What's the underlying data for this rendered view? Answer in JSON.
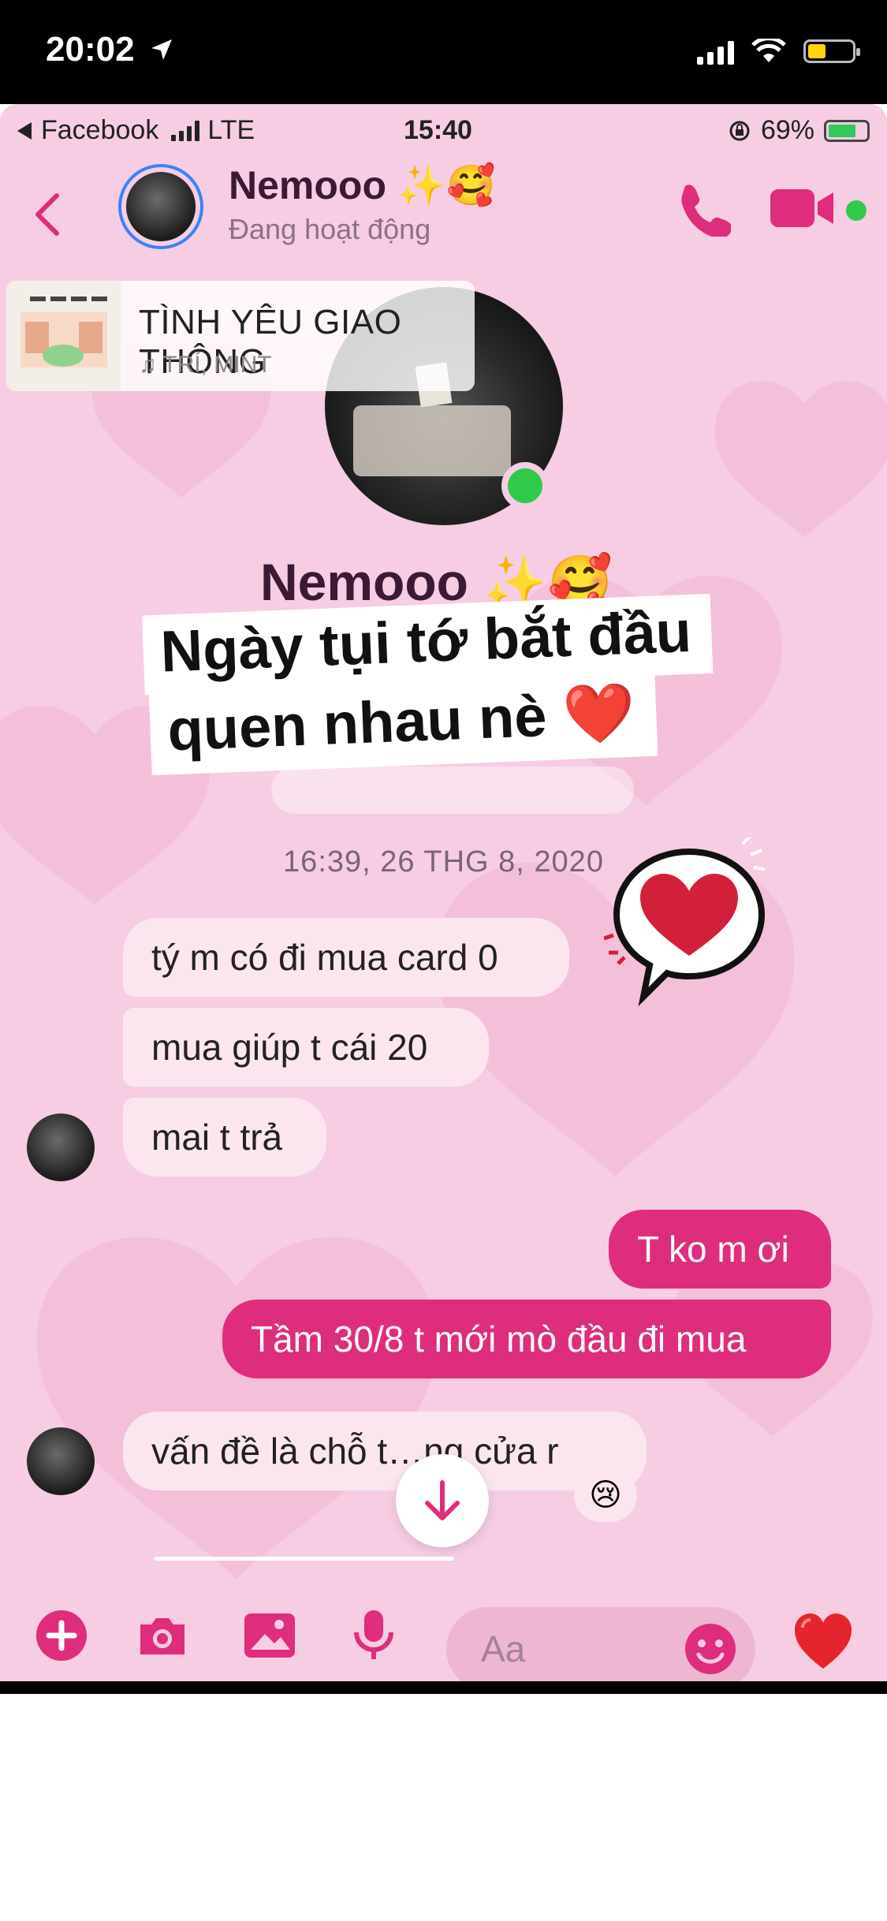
{
  "outer_status": {
    "time": "20:02"
  },
  "inner_status": {
    "carrier": "Facebook",
    "network": "LTE",
    "time": "15:40",
    "battery": "69%"
  },
  "header": {
    "name": "Nemooo ✨🥰",
    "status": "Đang hoạt động"
  },
  "music": {
    "title": "TÌNH YÊU GIAO THÔNG",
    "artist": "♫ TRÍ, MINT"
  },
  "profile": {
    "name": "Nemooo ✨🥰"
  },
  "caption": {
    "line1": "Ngày tụi tớ bắt đầu",
    "line2": "quen nhau nè ❤️"
  },
  "timestamp": "16:39, 26 THG 8, 2020",
  "messages": [
    {
      "from": "them",
      "text": "tý m có đi mua card 0"
    },
    {
      "from": "them",
      "text": "mua giúp t cái 20"
    },
    {
      "from": "them",
      "text": "mai t trả"
    },
    {
      "from": "me",
      "text": "T ko m ơi"
    },
    {
      "from": "me",
      "text": "Tầm 30/8 t mới mò đầu đi mua"
    },
    {
      "from": "them",
      "text": "vấn đề là chỗ t…ng cửa r"
    }
  ],
  "reaction": "😢",
  "composer": {
    "placeholder": "Aa",
    "like": "❤️"
  },
  "colors": {
    "accent": "#de2d7c",
    "background": "#f6cde3",
    "online": "#31c94a"
  }
}
